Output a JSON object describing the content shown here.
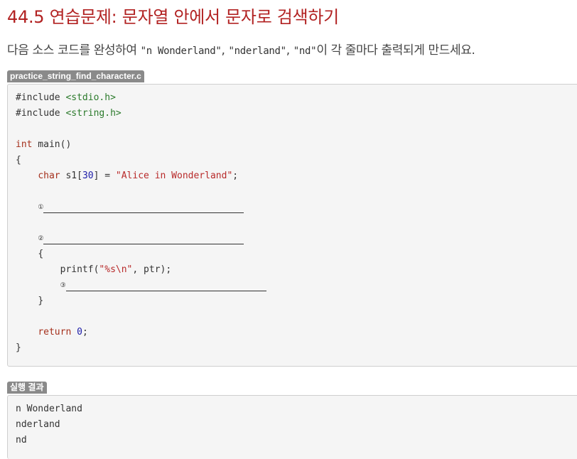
{
  "header": {
    "title": "44.5 연습문제: 문자열 안에서 문자로 검색하기"
  },
  "description": {
    "text_before": "다음 소스 코드를 완성하여 ",
    "item1": "\"n Wonderland\"",
    "sep1": ", ",
    "item2": "\"nderland\"",
    "sep2": ", ",
    "item3": "\"nd\"",
    "text_after": "이 각 줄마다 출력되게 만드세요."
  },
  "code_block": {
    "filename": "practice_string_find_character.c",
    "include1_kw": "#include",
    "include1_hdr": "<stdio.h>",
    "include2_kw": "#include",
    "include2_hdr": "<string.h>",
    "main_type": "int",
    "main_sig": " main()",
    "open_brace": "{",
    "char_kw": "char",
    "decl_name": " s1[",
    "decl_size": "30",
    "decl_mid": "] = ",
    "decl_str": "\"Alice in Wonderland\"",
    "decl_end": ";",
    "blank1_num": "①",
    "blank2_num": "②",
    "inner_open": "{",
    "printf_start": "printf(",
    "printf_str": "\"%s\\n\"",
    "printf_end": ", ptr);",
    "blank3_num": "③",
    "inner_close": "}",
    "return_kw": "return",
    "return_val": "0",
    "return_end": ";",
    "close_brace": "}"
  },
  "result_block": {
    "label": "실행 결과",
    "lines": [
      "n Wonderland",
      "nderland",
      "nd"
    ]
  }
}
